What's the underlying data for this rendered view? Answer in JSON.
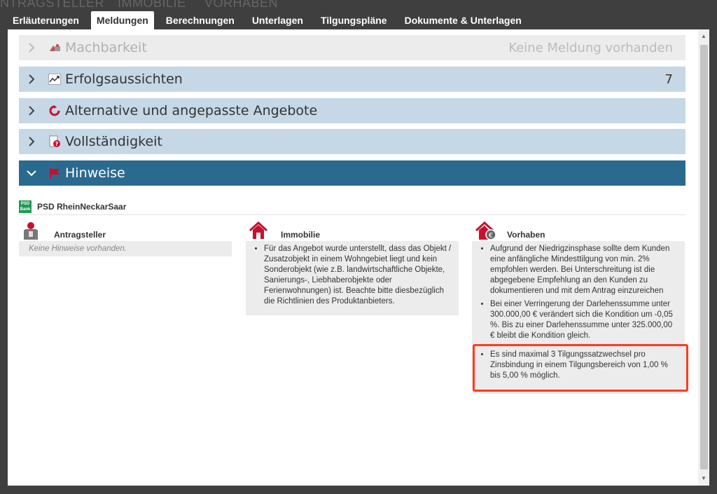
{
  "background_tabs": [
    "NTRAGSTELLER",
    "IMMOBILIE",
    "VORHABEN"
  ],
  "tabs": [
    {
      "label": "Erläuterungen",
      "active": false
    },
    {
      "label": "Meldungen",
      "active": true
    },
    {
      "label": "Berechnungen",
      "active": false
    },
    {
      "label": "Unterlagen",
      "active": false
    },
    {
      "label": "Tilgungspläne",
      "active": false
    },
    {
      "label": "Dokumente & Unterlagen",
      "active": false
    }
  ],
  "accordion": {
    "machbarkeit": {
      "title": "Machbarkeit",
      "status": "Keine Meldung vorhanden"
    },
    "erfolg": {
      "title": "Erfolgsaussichten",
      "count": "7"
    },
    "alternativ": {
      "title": "Alternative und angepasste Angebote"
    },
    "vollst": {
      "title": "Vollständigkeit"
    },
    "hinweise": {
      "title": "Hinweise"
    }
  },
  "bank": {
    "logo_top": "PSD",
    "logo_bottom": "Bank",
    "name": "PSD RheinNeckarSaar"
  },
  "columns": {
    "antragsteller": {
      "title": "Antragsteller",
      "empty": "Keine Hinweise vorhanden."
    },
    "immobilie": {
      "title": "Immobilie",
      "items": [
        "Für das Angebot wurde unterstellt, dass das Objekt / Zusatzobjekt in einem Wohngebiet liegt und kein Sonderobjekt (wie z.B. landwirtschaftliche Objekte, Sanierungs-, Liebhaberobjekte oder Ferienwohnungen) ist. Beachte bitte diesbezüglich die Richtlinien des Produktanbieters."
      ]
    },
    "vorhaben": {
      "title": "Vorhaben",
      "items": [
        "Aufgrund der Niedrigzinsphase sollte dem Kunden eine anfängliche Mindesttilgung von min. 2% empfohlen werden. Bei Unterschreitung ist die abgegebene Empfehlung an den Kunden zu dokumentieren und mit dem Antrag einzureichen",
        "Bei einer Verringerung der Darlehenssumme unter 300.000,00 € verändert sich die Kondition um -0,05 %. Bis zu einer Darlehenssumme unter 325.000,00 € bleibt die Kondition gleich.",
        "Es sind maximal 3 Tilgungssatzwechsel pro Zinsbindung in einem Tilgungsbereich von 1,00 % bis 5,00 % möglich."
      ]
    }
  },
  "colors": {
    "accent_dark": "#2b6a8f",
    "accent_light": "#c6d8e6",
    "highlight": "#ff3b1f",
    "icon_red": "#c8102e"
  }
}
